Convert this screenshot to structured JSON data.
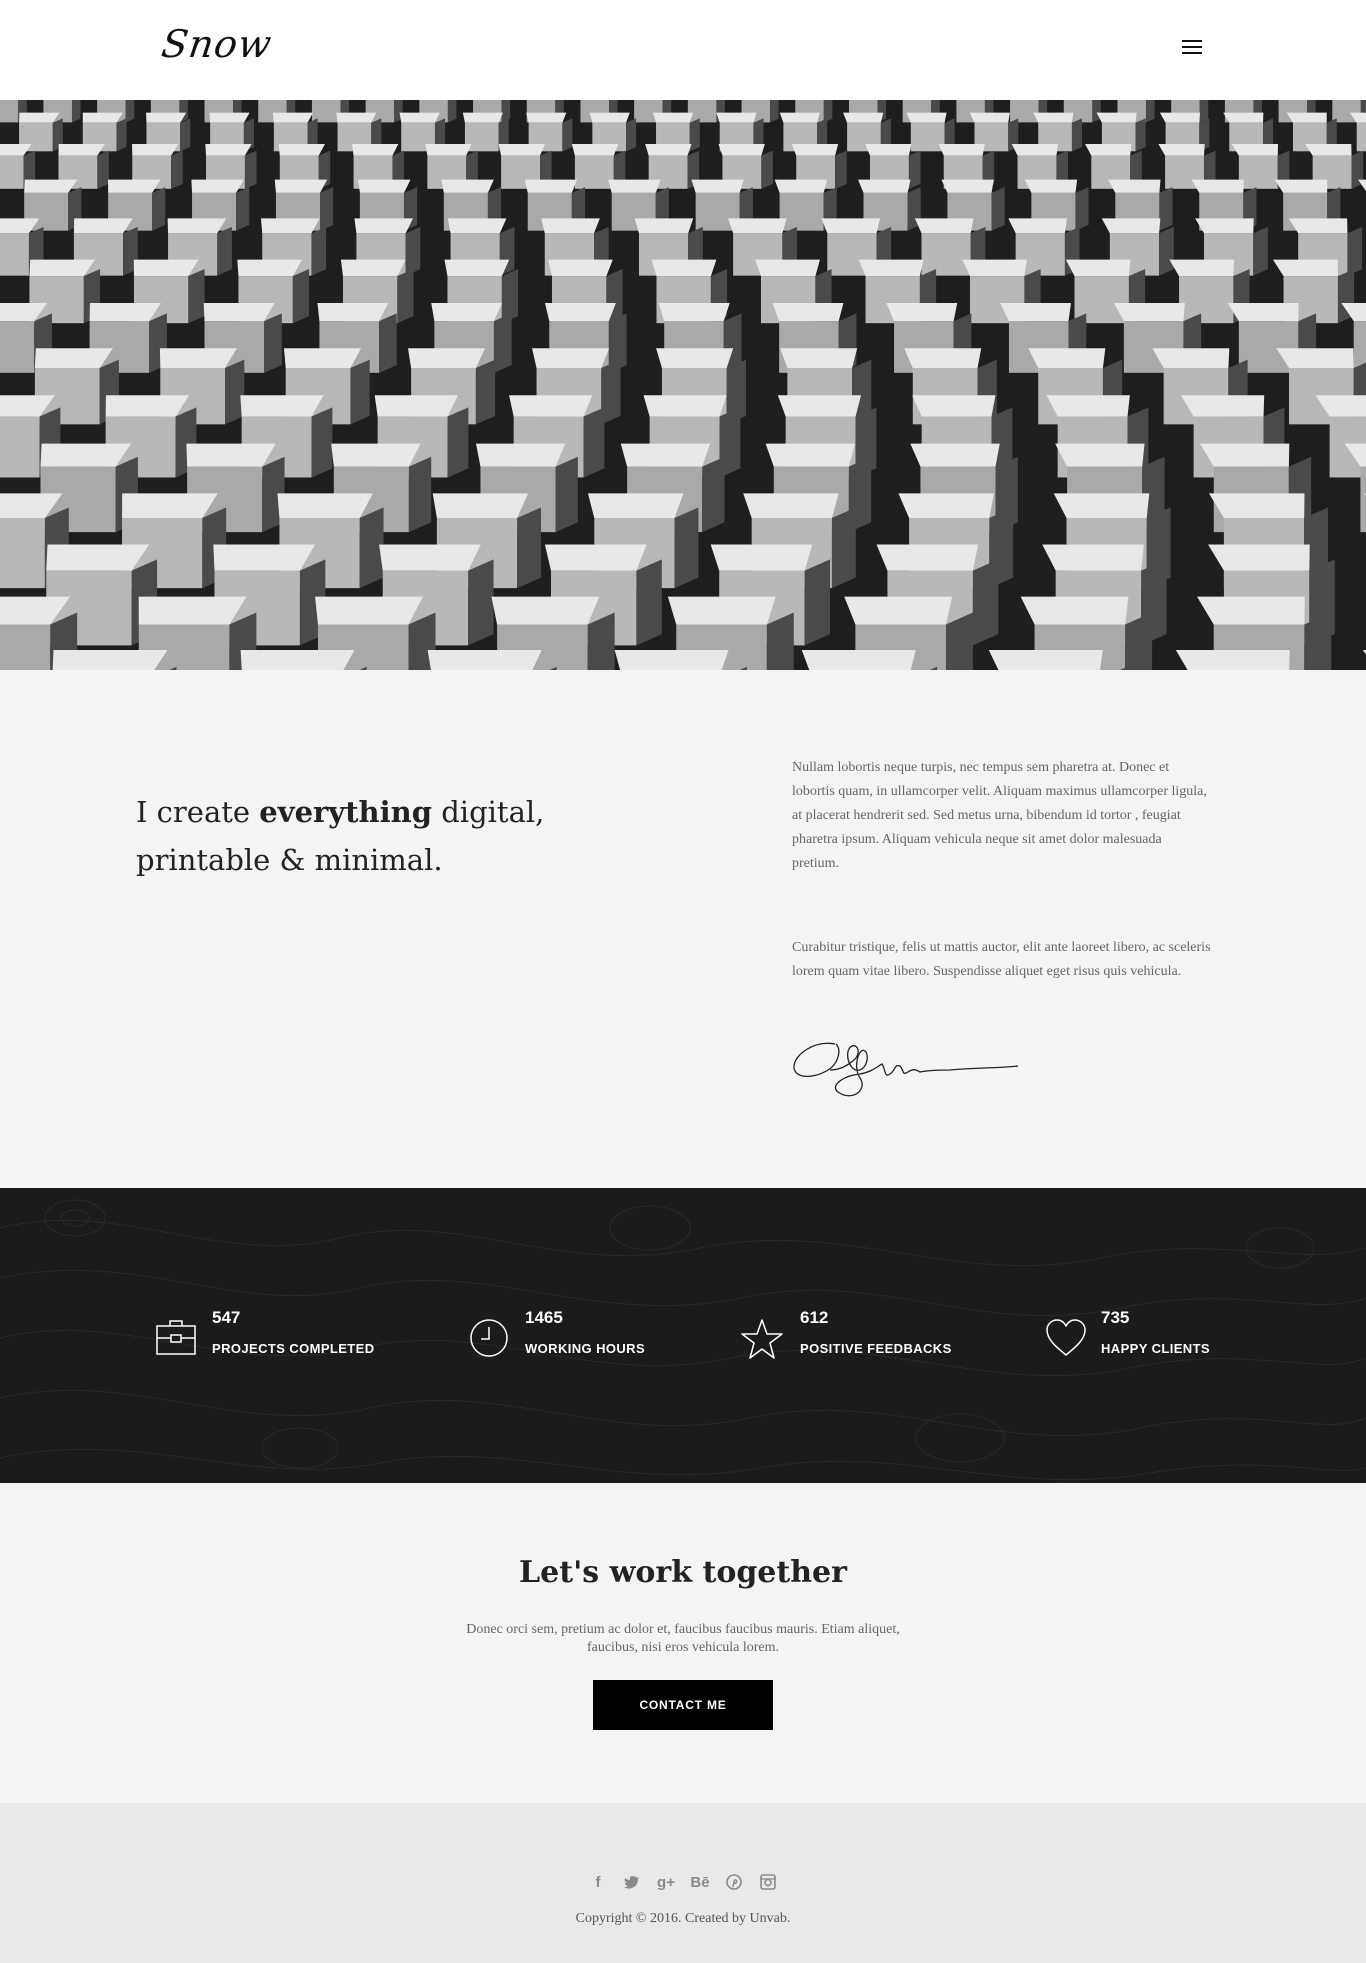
{
  "header": {
    "logo": "Snow",
    "menu_icon": "hamburger-menu-icon"
  },
  "hero": {
    "image": "black-and-white concrete facade pattern"
  },
  "intro": {
    "tagline_part1": "I create ",
    "tagline_bold": "everything",
    "tagline_part2": " digital,",
    "tagline_line2": "printable & minimal.",
    "paragraph1": "Nullam lobortis neque turpis, nec tempus sem pharetra at. Donec et lobortis quam, in ullamcorper velit. Aliquam maximus ullamcorper ligula, at placerat hendrerit sed. Sed metus urna, bibendum id tortor , feugiat pharetra ipsum. Aliquam vehicula neque sit amet dolor malesuada pretium.",
    "paragraph2": "Curabitur tristique, felis ut mattis auctor, elit ante laoreet libero, ac sceleris lorem quam vitae libero. Suspendisse aliquet eget risus quis vehicula.",
    "signature_icon": "handwritten-signature"
  },
  "stats": [
    {
      "number": "547",
      "label": "PROJECTS COMPLETED",
      "icon": "briefcase-icon"
    },
    {
      "number": "1465",
      "label": "WORKING HOURS",
      "icon": "clock-icon"
    },
    {
      "number": "612",
      "label": "POSITIVE FEEDBACKS",
      "icon": "star-icon"
    },
    {
      "number": "735",
      "label": "HAPPY CLIENTS",
      "icon": "heart-icon"
    }
  ],
  "cta": {
    "title": "Let's work together",
    "text_line1": "Donec orci sem, pretium ac dolor et, faucibus faucibus mauris. Etiam aliquet,",
    "text_line2": "faucibus, nisi eros vehicula lorem.",
    "button_label": "CONTACT ME"
  },
  "footer": {
    "socials": [
      {
        "name": "facebook-icon",
        "glyph": "f"
      },
      {
        "name": "twitter-icon",
        "glyph": "t"
      },
      {
        "name": "google-plus-icon",
        "glyph": "g+"
      },
      {
        "name": "behance-icon",
        "glyph": "Bē"
      },
      {
        "name": "pinterest-icon",
        "glyph": "p"
      },
      {
        "name": "instagram-icon",
        "glyph": "ig"
      }
    ],
    "copyright": "Copyright © 2016. Created by Unvab."
  },
  "colors": {
    "dark_band": "#1b1b1c",
    "button": "#000000",
    "page_bg": "#f4f4f4",
    "footer_bg": "#e9e9e9"
  }
}
